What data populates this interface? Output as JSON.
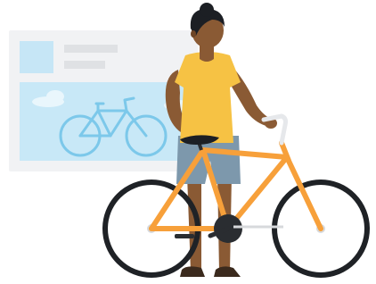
{
  "illustration": {
    "colors": {
      "card_background": "#f1f2f4",
      "card_thumbnail": "#c6e6f6",
      "card_text_line": "#dfe1e4",
      "card_image": "#c8e8f7",
      "card_image_cloud": "#e9f6fc",
      "card_bike": "#7cc8ea",
      "skin": "#8a5a34",
      "skin_shadow": "#6e4526",
      "hair": "#1c1f24",
      "shirt": "#f6c244",
      "shorts": "#7d98ac",
      "bike_frame": "#f7a03a",
      "tire": "#1f2226",
      "hub": "#d7d9dc",
      "crank": "#2a2d31",
      "handlebar": "#e6e8eb",
      "shoe": "#3b2a1d"
    }
  }
}
